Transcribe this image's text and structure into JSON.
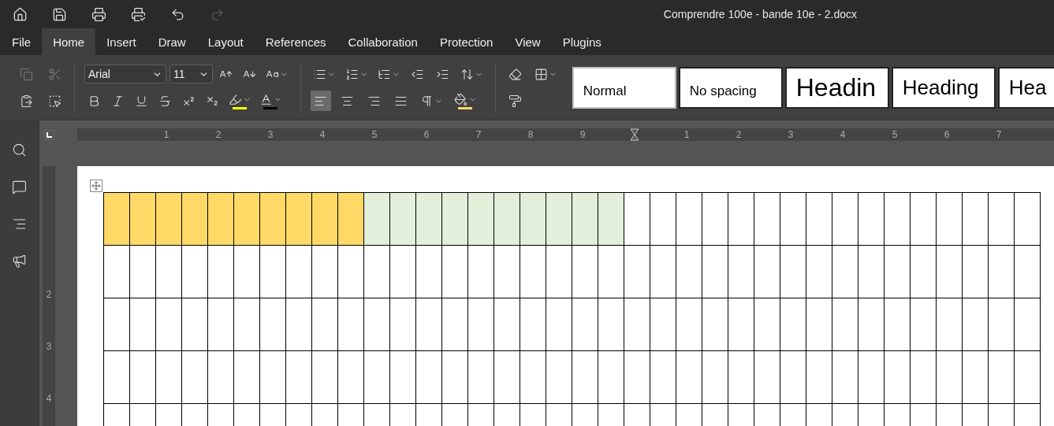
{
  "window": {
    "title": "Comprendre 100e - bande 10e - 2.docx"
  },
  "quick_access": [
    {
      "kind": "home",
      "disabled": false
    },
    {
      "kind": "save",
      "disabled": false
    },
    {
      "kind": "print",
      "disabled": false
    },
    {
      "kind": "quick_print",
      "disabled": false
    },
    {
      "kind": "undo",
      "disabled": false
    },
    {
      "kind": "redo",
      "disabled": true
    }
  ],
  "menu": [
    {
      "label": "File",
      "selected": false
    },
    {
      "label": "Home",
      "selected": true
    },
    {
      "label": "Insert",
      "selected": false
    },
    {
      "label": "Draw",
      "selected": false
    },
    {
      "label": "Layout",
      "selected": false
    },
    {
      "label": "References",
      "selected": false
    },
    {
      "label": "Collaboration",
      "selected": false
    },
    {
      "label": "Protection",
      "selected": false
    },
    {
      "label": "View",
      "selected": false
    },
    {
      "label": "Plugins",
      "selected": false
    }
  ],
  "ribbon": {
    "clipboard": [
      {
        "kind": "copy",
        "disabled": true
      },
      {
        "kind": "cut",
        "disabled": true
      },
      {
        "kind": "paste",
        "disabled": false
      },
      {
        "kind": "select",
        "disabled": false
      }
    ],
    "font": {
      "name": "Arial",
      "size": "11"
    },
    "font_tools": [
      {
        "kind": "grow"
      },
      {
        "kind": "shrink"
      },
      {
        "kind": "case"
      }
    ],
    "format": [
      {
        "kind": "bold"
      },
      {
        "kind": "italic"
      },
      {
        "kind": "underline"
      },
      {
        "kind": "strike"
      },
      {
        "kind": "sup"
      },
      {
        "kind": "sub"
      },
      {
        "kind": "highlight",
        "color": "#ffff00"
      },
      {
        "kind": "font_color",
        "color": "#000000"
      }
    ],
    "paragraph": [
      {
        "kind": "bullets"
      },
      {
        "kind": "numbering"
      },
      {
        "kind": "multilevel"
      },
      {
        "kind": "outdent"
      },
      {
        "kind": "indent"
      },
      {
        "kind": "spacing"
      }
    ],
    "alignment": [
      {
        "kind": "left",
        "selected": true
      },
      {
        "kind": "center",
        "selected": false
      },
      {
        "kind": "right",
        "selected": false
      },
      {
        "kind": "justify",
        "selected": false
      }
    ],
    "paragraph_tools": [
      {
        "kind": "marks"
      },
      {
        "kind": "shading",
        "color": "#ffd966"
      }
    ],
    "misc_top": [
      {
        "kind": "eraser"
      },
      {
        "kind": "borders"
      }
    ],
    "misc_bottom": [
      {
        "kind": "painter"
      }
    ],
    "styles": [
      {
        "label": "Normal",
        "kind": "normal",
        "selected": true
      },
      {
        "label": "No spacing",
        "kind": "normal",
        "selected": false
      },
      {
        "label": "Headin",
        "kind": "large",
        "selected": false
      },
      {
        "label": "Heading",
        "kind": "medium",
        "selected": false
      },
      {
        "label": "Hea",
        "kind": "medium",
        "selected": false
      }
    ]
  },
  "sidebar": [
    {
      "kind": "search"
    },
    {
      "kind": "comments"
    },
    {
      "kind": "navigation"
    },
    {
      "kind": "feedback"
    }
  ],
  "ruler": {
    "left_labels": [
      "1",
      "2",
      "3",
      "4",
      "5",
      "6",
      "7",
      "8",
      "9"
    ],
    "right_labels": [
      "1",
      "2",
      "3",
      "4",
      "5",
      "6",
      "7"
    ],
    "vertical_labels": [
      "2",
      "3",
      "4"
    ]
  },
  "table": {
    "rows": [
      {
        "cells": [
          {
            "color": "#ffd966"
          },
          {
            "color": "#ffd966"
          },
          {
            "color": "#ffd966"
          },
          {
            "color": "#ffd966"
          },
          {
            "color": "#ffd966"
          },
          {
            "color": "#ffd966"
          },
          {
            "color": "#ffd966"
          },
          {
            "color": "#ffd966"
          },
          {
            "color": "#ffd966"
          },
          {
            "color": "#ffd966"
          },
          {
            "color": "#e2efda"
          },
          {
            "color": "#e2efda"
          },
          {
            "color": "#e2efda"
          },
          {
            "color": "#e2efda"
          },
          {
            "color": "#e2efda"
          },
          {
            "color": "#e2efda"
          },
          {
            "color": "#e2efda"
          },
          {
            "color": "#e2efda"
          },
          {
            "color": "#e2efda"
          },
          {
            "color": "#e2efda"
          },
          {
            "color": "#ffffff"
          },
          {
            "color": "#ffffff"
          },
          {
            "color": "#ffffff"
          },
          {
            "color": "#ffffff"
          },
          {
            "color": "#ffffff"
          },
          {
            "color": "#ffffff"
          },
          {
            "color": "#ffffff"
          },
          {
            "color": "#ffffff"
          },
          {
            "color": "#ffffff"
          },
          {
            "color": "#ffffff"
          },
          {
            "color": "#ffffff"
          },
          {
            "color": "#ffffff"
          },
          {
            "color": "#ffffff"
          },
          {
            "color": "#ffffff"
          },
          {
            "color": "#ffffff"
          },
          {
            "color": "#ffffff"
          }
        ]
      },
      {
        "cells": [
          {
            "color": "#ffffff"
          },
          {
            "color": "#ffffff"
          },
          {
            "color": "#ffffff"
          },
          {
            "color": "#ffffff"
          },
          {
            "color": "#ffffff"
          },
          {
            "color": "#ffffff"
          },
          {
            "color": "#ffffff"
          },
          {
            "color": "#ffffff"
          },
          {
            "color": "#ffffff"
          },
          {
            "color": "#ffffff"
          },
          {
            "color": "#ffffff"
          },
          {
            "color": "#ffffff"
          },
          {
            "color": "#ffffff"
          },
          {
            "color": "#ffffff"
          },
          {
            "color": "#ffffff"
          },
          {
            "color": "#ffffff"
          },
          {
            "color": "#ffffff"
          },
          {
            "color": "#ffffff"
          },
          {
            "color": "#ffffff"
          },
          {
            "color": "#ffffff"
          },
          {
            "color": "#ffffff"
          },
          {
            "color": "#ffffff"
          },
          {
            "color": "#ffffff"
          },
          {
            "color": "#ffffff"
          },
          {
            "color": "#ffffff"
          },
          {
            "color": "#ffffff"
          },
          {
            "color": "#ffffff"
          },
          {
            "color": "#ffffff"
          },
          {
            "color": "#ffffff"
          },
          {
            "color": "#ffffff"
          },
          {
            "color": "#ffffff"
          },
          {
            "color": "#ffffff"
          },
          {
            "color": "#ffffff"
          },
          {
            "color": "#ffffff"
          },
          {
            "color": "#ffffff"
          },
          {
            "color": "#ffffff"
          }
        ]
      },
      {
        "cells": [
          {
            "color": "#ffffff"
          },
          {
            "color": "#ffffff"
          },
          {
            "color": "#ffffff"
          },
          {
            "color": "#ffffff"
          },
          {
            "color": "#ffffff"
          },
          {
            "color": "#ffffff"
          },
          {
            "color": "#ffffff"
          },
          {
            "color": "#ffffff"
          },
          {
            "color": "#ffffff"
          },
          {
            "color": "#ffffff"
          },
          {
            "color": "#ffffff"
          },
          {
            "color": "#ffffff"
          },
          {
            "color": "#ffffff"
          },
          {
            "color": "#ffffff"
          },
          {
            "color": "#ffffff"
          },
          {
            "color": "#ffffff"
          },
          {
            "color": "#ffffff"
          },
          {
            "color": "#ffffff"
          },
          {
            "color": "#ffffff"
          },
          {
            "color": "#ffffff"
          },
          {
            "color": "#ffffff"
          },
          {
            "color": "#ffffff"
          },
          {
            "color": "#ffffff"
          },
          {
            "color": "#ffffff"
          },
          {
            "color": "#ffffff"
          },
          {
            "color": "#ffffff"
          },
          {
            "color": "#ffffff"
          },
          {
            "color": "#ffffff"
          },
          {
            "color": "#ffffff"
          },
          {
            "color": "#ffffff"
          },
          {
            "color": "#ffffff"
          },
          {
            "color": "#ffffff"
          },
          {
            "color": "#ffffff"
          },
          {
            "color": "#ffffff"
          },
          {
            "color": "#ffffff"
          },
          {
            "color": "#ffffff"
          }
        ]
      },
      {
        "cells": [
          {
            "color": "#ffffff"
          },
          {
            "color": "#ffffff"
          },
          {
            "color": "#ffffff"
          },
          {
            "color": "#ffffff"
          },
          {
            "color": "#ffffff"
          },
          {
            "color": "#ffffff"
          },
          {
            "color": "#ffffff"
          },
          {
            "color": "#ffffff"
          },
          {
            "color": "#ffffff"
          },
          {
            "color": "#ffffff"
          },
          {
            "color": "#ffffff"
          },
          {
            "color": "#ffffff"
          },
          {
            "color": "#ffffff"
          },
          {
            "color": "#ffffff"
          },
          {
            "color": "#ffffff"
          },
          {
            "color": "#ffffff"
          },
          {
            "color": "#ffffff"
          },
          {
            "color": "#ffffff"
          },
          {
            "color": "#ffffff"
          },
          {
            "color": "#ffffff"
          },
          {
            "color": "#ffffff"
          },
          {
            "color": "#ffffff"
          },
          {
            "color": "#ffffff"
          },
          {
            "color": "#ffffff"
          },
          {
            "color": "#ffffff"
          },
          {
            "color": "#ffffff"
          },
          {
            "color": "#ffffff"
          },
          {
            "color": "#ffffff"
          },
          {
            "color": "#ffffff"
          },
          {
            "color": "#ffffff"
          },
          {
            "color": "#ffffff"
          },
          {
            "color": "#ffffff"
          },
          {
            "color": "#ffffff"
          },
          {
            "color": "#ffffff"
          },
          {
            "color": "#ffffff"
          },
          {
            "color": "#ffffff"
          }
        ]
      },
      {
        "cells": [
          {
            "color": "#ffffff"
          },
          {
            "color": "#ffffff"
          },
          {
            "color": "#ffffff"
          },
          {
            "color": "#ffffff"
          },
          {
            "color": "#ffffff"
          },
          {
            "color": "#ffffff"
          },
          {
            "color": "#ffffff"
          },
          {
            "color": "#ffffff"
          },
          {
            "color": "#ffffff"
          },
          {
            "color": "#ffffff"
          },
          {
            "color": "#ffffff"
          },
          {
            "color": "#ffffff"
          },
          {
            "color": "#ffffff"
          },
          {
            "color": "#ffffff"
          },
          {
            "color": "#ffffff"
          },
          {
            "color": "#ffffff"
          },
          {
            "color": "#ffffff"
          },
          {
            "color": "#ffffff"
          },
          {
            "color": "#ffffff"
          },
          {
            "color": "#ffffff"
          },
          {
            "color": "#ffffff"
          },
          {
            "color": "#ffffff"
          },
          {
            "color": "#ffffff"
          },
          {
            "color": "#ffffff"
          },
          {
            "color": "#ffffff"
          },
          {
            "color": "#ffffff"
          },
          {
            "color": "#ffffff"
          },
          {
            "color": "#ffffff"
          },
          {
            "color": "#ffffff"
          },
          {
            "color": "#ffffff"
          },
          {
            "color": "#ffffff"
          },
          {
            "color": "#ffffff"
          },
          {
            "color": "#ffffff"
          },
          {
            "color": "#ffffff"
          },
          {
            "color": "#ffffff"
          },
          {
            "color": "#ffffff"
          }
        ]
      }
    ]
  }
}
